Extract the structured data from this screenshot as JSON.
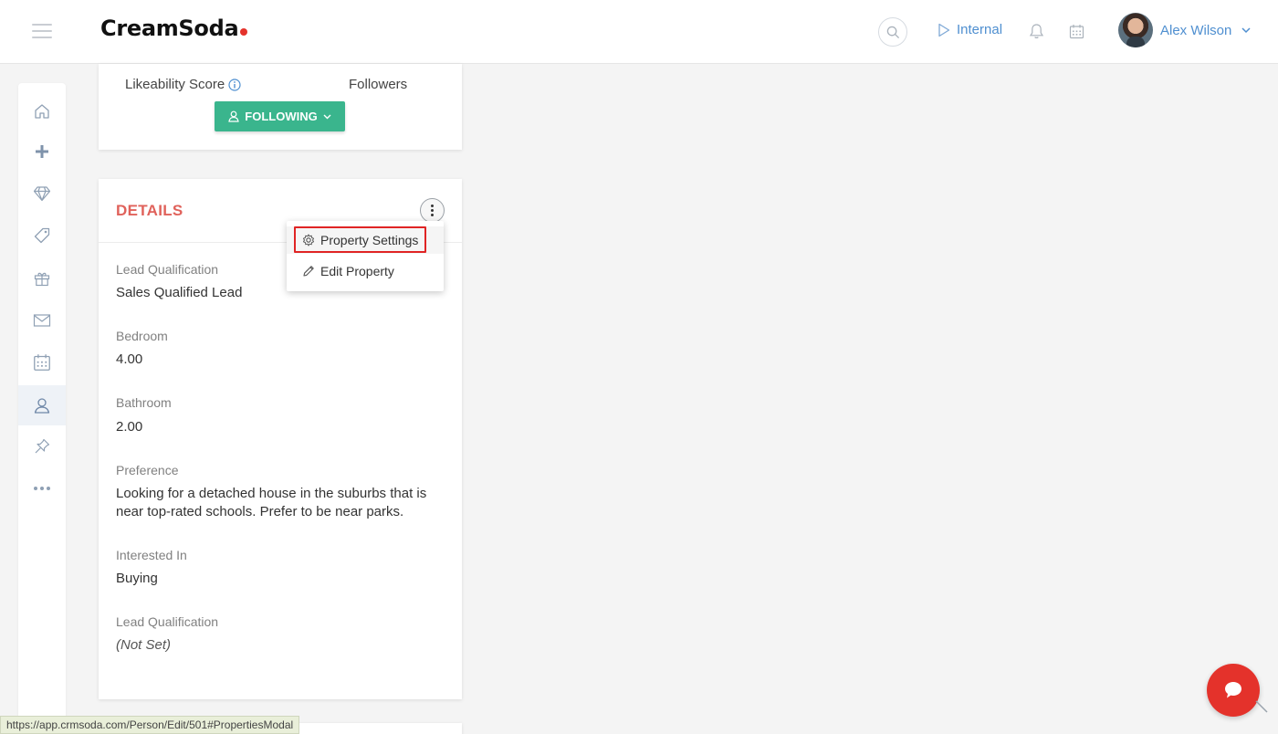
{
  "header": {
    "brand": "CreamSoda",
    "brand_dot_color": "#e4322b",
    "internal_label": "Internal",
    "user_name": "Alex Wilson",
    "icons": [
      "hamburger-icon",
      "search-icon",
      "play-icon",
      "bell-icon",
      "calendar-icon",
      "chevron-down-icon"
    ]
  },
  "sidebar": {
    "items": [
      {
        "name": "home",
        "icon": "home-icon"
      },
      {
        "name": "add",
        "icon": "plus-icon"
      },
      {
        "name": "deals",
        "icon": "diamond-icon"
      },
      {
        "name": "tags",
        "icon": "tag-icon"
      },
      {
        "name": "gifts",
        "icon": "gift-icon"
      },
      {
        "name": "mail",
        "icon": "mail-icon"
      },
      {
        "name": "calendar",
        "icon": "calendar-icon"
      },
      {
        "name": "people",
        "icon": "person-icon",
        "active": true
      },
      {
        "name": "pins",
        "icon": "pin-icon"
      },
      {
        "name": "more",
        "icon": "more-icon"
      }
    ]
  },
  "profile": {
    "likeability_label": "Likeability Score",
    "followers_label": "Followers",
    "following_button": "FOLLOWING"
  },
  "details": {
    "title": "DETAILS",
    "title_color": "#e0625b",
    "fields": [
      {
        "label": "Lead Qualification",
        "value": "Sales Qualified Lead"
      },
      {
        "label": "Bedroom",
        "value": "4.00"
      },
      {
        "label": "Bathroom",
        "value": "2.00"
      },
      {
        "label": "Preference",
        "value": "Looking for a detached house in the suburbs that is near top-rated schools. Prefer to be near parks."
      },
      {
        "label": "Interested In",
        "value": "Buying"
      },
      {
        "label": "Lead Qualification",
        "value": "(Not Set)"
      }
    ]
  },
  "dropdown": {
    "items": [
      {
        "label": "Property Settings",
        "icon": "gear-icon"
      },
      {
        "label": "Edit Property",
        "icon": "pencil-icon"
      }
    ]
  },
  "status_url": "https://app.crmsoda.com/Person/Edit/501#PropertiesModal",
  "colors": {
    "accent": "#4f8fd0",
    "following_green": "#3ab58d",
    "chat_red": "#e4322b",
    "highlight_red": "#e02424"
  }
}
